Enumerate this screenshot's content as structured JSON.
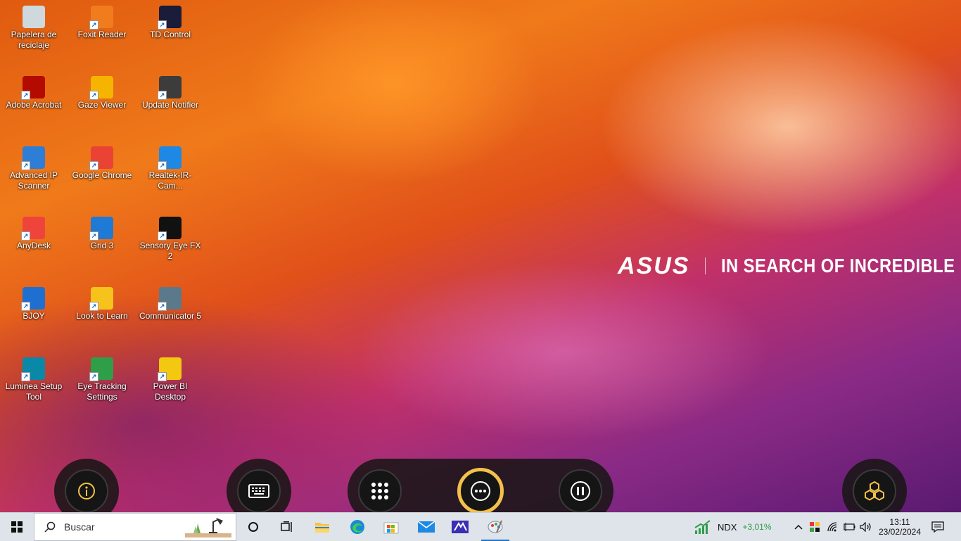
{
  "desktop": {
    "icons": [
      {
        "label": "Papelera de reciclaje",
        "icon": "recycle-bin-icon",
        "color": "#cfd8dc"
      },
      {
        "label": "Foxit Reader",
        "icon": "foxit-reader-icon",
        "color": "#f07c1e"
      },
      {
        "label": "TD Control",
        "icon": "td-control-icon",
        "color": "#1b1b3a"
      },
      {
        "label": "Adobe Acrobat",
        "icon": "adobe-acrobat-icon",
        "color": "#b30b00"
      },
      {
        "label": "Gaze Viewer",
        "icon": "gaze-viewer-icon",
        "color": "#f5b400"
      },
      {
        "label": "Update Notifier",
        "icon": "update-notifier-icon",
        "color": "#3c3c3c"
      },
      {
        "label": "Advanced IP Scanner",
        "icon": "advanced-ip-scanner-icon",
        "color": "#2e7dd7"
      },
      {
        "label": "Google Chrome",
        "icon": "chrome-icon",
        "color": "#ea4335"
      },
      {
        "label": "Realtek-IR-Cam...",
        "icon": "realtek-ir-camera-icon",
        "color": "#1e88e5"
      },
      {
        "label": "AnyDesk",
        "icon": "anydesk-icon",
        "color": "#ef443b"
      },
      {
        "label": "Grid 3",
        "icon": "grid-3-icon",
        "color": "#1f7ad6"
      },
      {
        "label": "Sensory Eye FX 2",
        "icon": "sensory-eye-fx-icon",
        "color": "#111111"
      },
      {
        "label": "BJOY",
        "icon": "bjoy-icon",
        "color": "#1f6fd1"
      },
      {
        "label": "Look to Learn",
        "icon": "look-to-learn-icon",
        "color": "#f6c21c"
      },
      {
        "label": "Communicator 5",
        "icon": "communicator-icon",
        "color": "#5a7a8c"
      },
      {
        "label": "Luminea Setup Tool",
        "icon": "luminea-setup-icon",
        "color": "#0a88a8"
      },
      {
        "label": "Eye Tracking Settings",
        "icon": "eye-tracking-settings-icon",
        "color": "#2e9e48"
      },
      {
        "label": "Power BI Desktop",
        "icon": "power-bi-icon",
        "color": "#f2c811"
      }
    ],
    "brand": {
      "logo": "ASUS",
      "tagline": "IN SEARCH OF INCREDIBLE"
    }
  },
  "gaze_toolbar": {
    "buttons": [
      {
        "name": "info",
        "icon": "info-icon"
      },
      {
        "name": "keyboard",
        "icon": "keyboard-icon"
      },
      {
        "name": "apps-grid",
        "icon": "grid-icon"
      },
      {
        "name": "more",
        "icon": "more-icon",
        "accent": "#f3c04a"
      },
      {
        "name": "pause",
        "icon": "pause-icon"
      },
      {
        "name": "cubes",
        "icon": "cubes-icon"
      }
    ]
  },
  "taskbar": {
    "search_placeholder": "Buscar",
    "apps": [
      "cortana-icon",
      "task-view-icon",
      "file-explorer-icon",
      "edge-icon",
      "store-icon",
      "mail-icon",
      "app-icon",
      "paint-icon"
    ],
    "stock": {
      "ticker": "NDX",
      "change": "+3,01%",
      "change_color": "#2e9e48"
    },
    "clock": {
      "time": "13:11",
      "date": "23/02/2024"
    }
  }
}
